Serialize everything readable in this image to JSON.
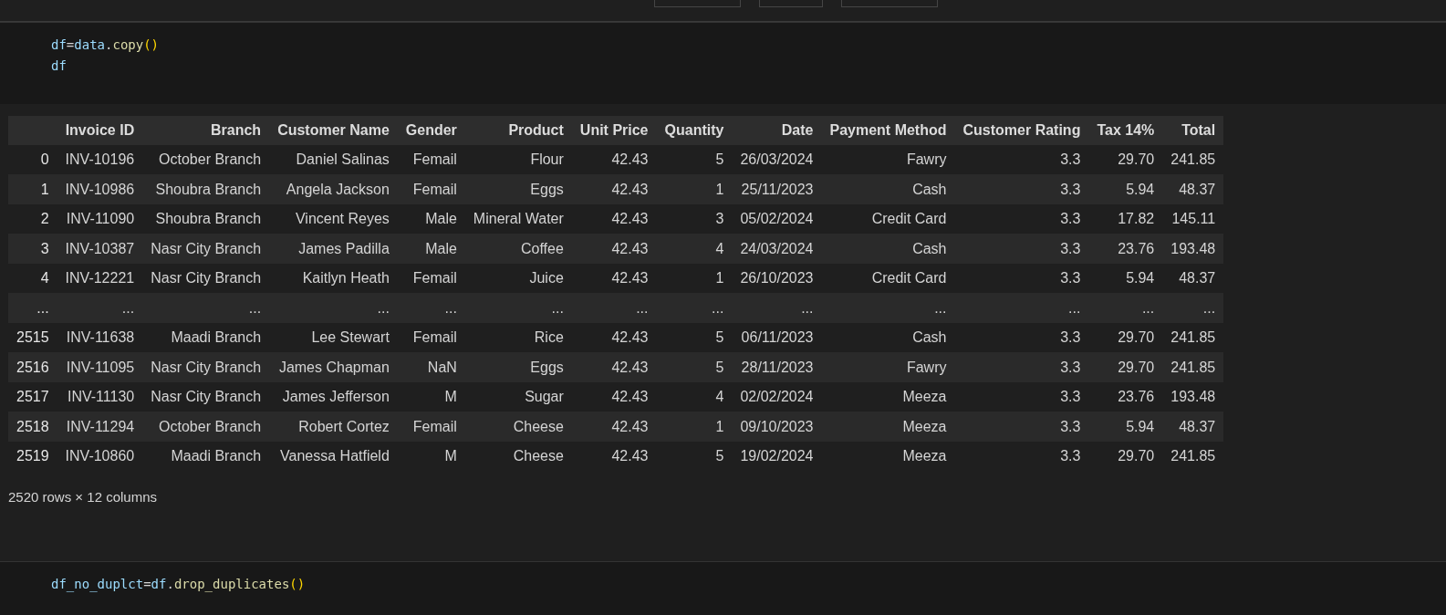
{
  "toolbar": {
    "buttons": [
      {
        "kind": "blank"
      },
      {
        "kind": "blank"
      },
      {
        "kind": "blank"
      }
    ]
  },
  "cells": [
    {
      "code": [
        [
          {
            "kind": "var",
            "text": "df"
          },
          {
            "kind": "op",
            "text": "="
          },
          {
            "kind": "var",
            "text": "data"
          },
          {
            "kind": "op",
            "text": "."
          },
          {
            "kind": "fn",
            "text": "copy"
          },
          {
            "kind": "paren",
            "text": "()"
          }
        ],
        [
          {
            "kind": "var",
            "text": "df"
          }
        ]
      ],
      "output": {
        "table": {
          "columns": [
            "",
            "Invoice ID",
            "Branch",
            "Customer Name",
            "Gender",
            "Product",
            "Unit Price",
            "Quantity",
            "Date",
            "Payment Method",
            "Customer Rating",
            "Tax 14%",
            "Total"
          ],
          "rows": [
            [
              "0",
              "INV-10196",
              "October Branch",
              "Daniel Salinas",
              "Femail",
              "Flour",
              "42.43",
              "5",
              "26/03/2024",
              "Fawry",
              "3.3",
              "29.70",
              "241.85"
            ],
            [
              "1",
              "INV-10986",
              "Shoubra Branch",
              "Angela Jackson",
              "Femail",
              "Eggs",
              "42.43",
              "1",
              "25/11/2023",
              "Cash",
              "3.3",
              "5.94",
              "48.37"
            ],
            [
              "2",
              "INV-11090",
              "Shoubra Branch",
              "Vincent Reyes",
              "Male",
              "Mineral Water",
              "42.43",
              "3",
              "05/02/2024",
              "Credit Card",
              "3.3",
              "17.82",
              "145.11"
            ],
            [
              "3",
              "INV-10387",
              "Nasr City Branch",
              "James Padilla",
              "Male",
              "Coffee",
              "42.43",
              "4",
              "24/03/2024",
              "Cash",
              "3.3",
              "23.76",
              "193.48"
            ],
            [
              "4",
              "INV-12221",
              "Nasr City Branch",
              "Kaitlyn Heath",
              "Femail",
              "Juice",
              "42.43",
              "1",
              "26/10/2023",
              "Credit Card",
              "3.3",
              "5.94",
              "48.37"
            ],
            [
              "...",
              "...",
              "...",
              "...",
              "...",
              "...",
              "...",
              "...",
              "...",
              "...",
              "...",
              "...",
              "..."
            ],
            [
              "2515",
              "INV-11638",
              "Maadi Branch",
              "Lee Stewart",
              "Femail",
              "Rice",
              "42.43",
              "5",
              "06/11/2023",
              "Cash",
              "3.3",
              "29.70",
              "241.85"
            ],
            [
              "2516",
              "INV-11095",
              "Nasr City Branch",
              "James Chapman",
              "NaN",
              "Eggs",
              "42.43",
              "5",
              "28/11/2023",
              "Fawry",
              "3.3",
              "29.70",
              "241.85"
            ],
            [
              "2517",
              "INV-11130",
              "Nasr City Branch",
              "James Jefferson",
              "M",
              "Sugar",
              "42.43",
              "4",
              "02/02/2024",
              "Meeza",
              "3.3",
              "23.76",
              "193.48"
            ],
            [
              "2518",
              "INV-11294",
              "October Branch",
              "Robert Cortez",
              "Femail",
              "Cheese",
              "42.43",
              "1",
              "09/10/2023",
              "Meeza",
              "3.3",
              "5.94",
              "48.37"
            ],
            [
              "2519",
              "INV-10860",
              "Maadi Branch",
              "Vanessa Hatfield",
              "M",
              "Cheese",
              "42.43",
              "5",
              "19/02/2024",
              "Meeza",
              "3.3",
              "29.70",
              "241.85"
            ]
          ]
        },
        "summary": "2520 rows × 12 columns"
      }
    },
    {
      "code": [
        [
          {
            "kind": "var",
            "text": "df_no_duplct"
          },
          {
            "kind": "op",
            "text": "="
          },
          {
            "kind": "var",
            "text": "df"
          },
          {
            "kind": "op",
            "text": "."
          },
          {
            "kind": "fn",
            "text": "drop_duplicates"
          },
          {
            "kind": "paren",
            "text": "()"
          }
        ]
      ]
    }
  ]
}
